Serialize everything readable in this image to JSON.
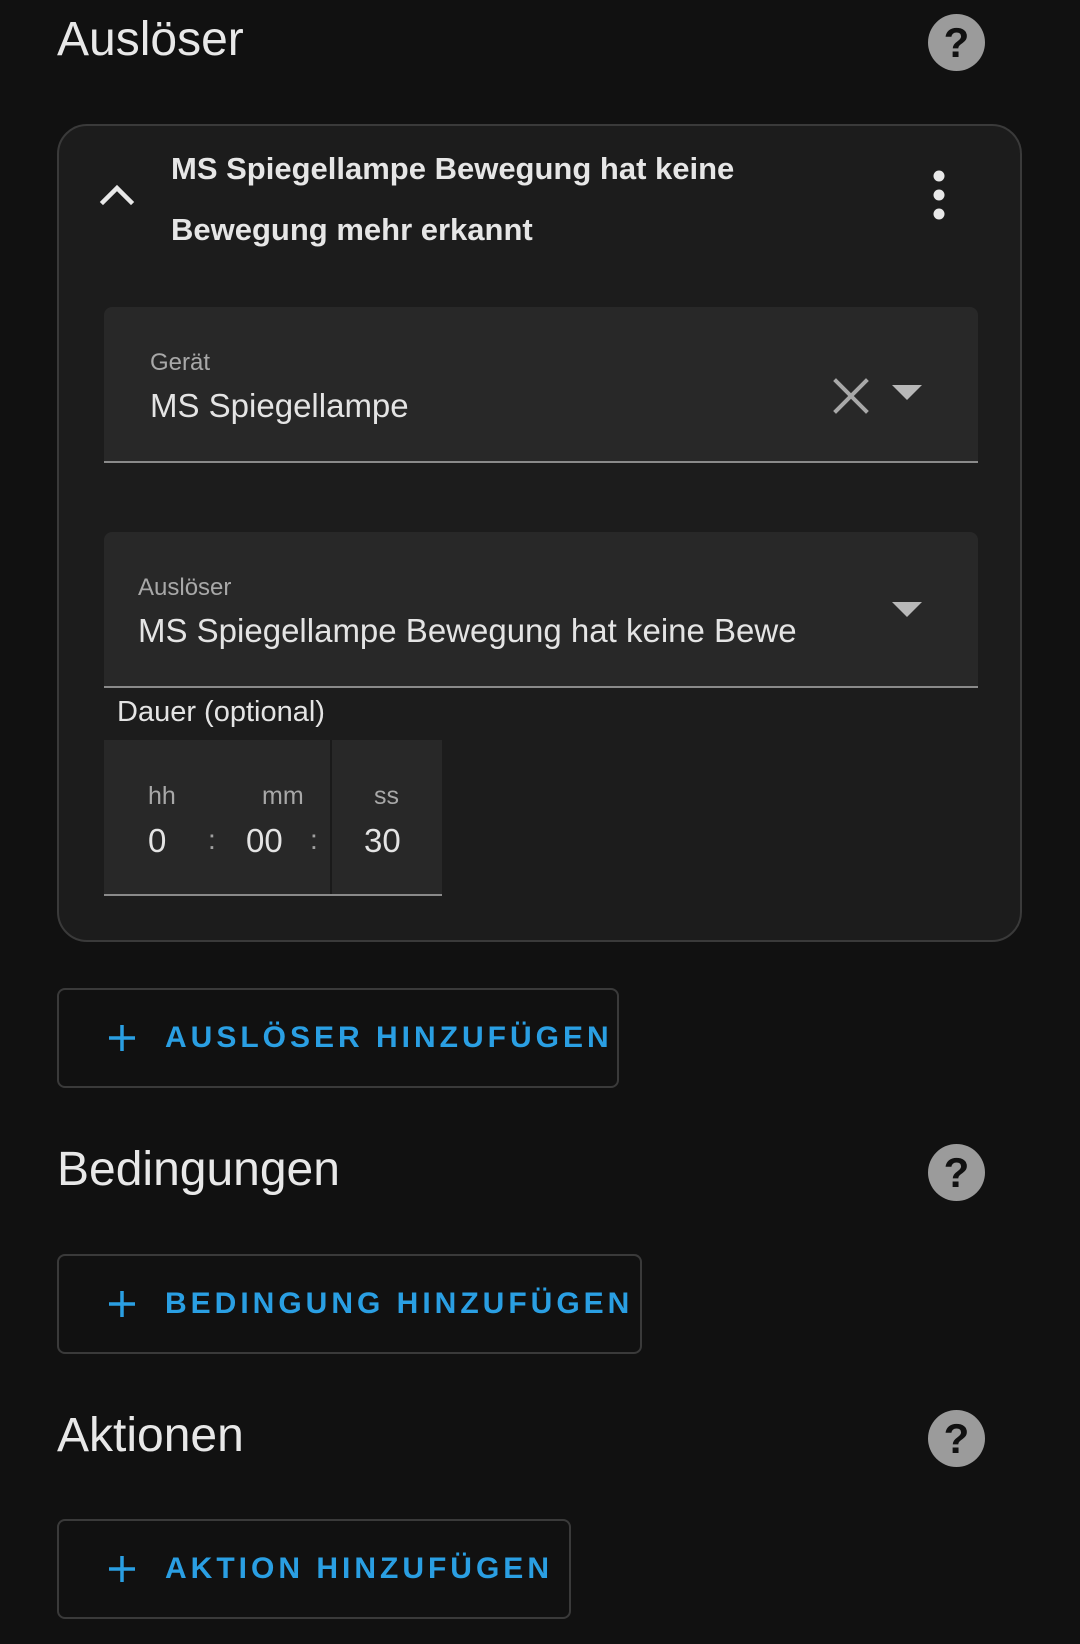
{
  "triggers_section": {
    "title": "Auslöser",
    "help_icon": "help-circle-icon",
    "trigger_card": {
      "title": "MS Spiegellampe Bewegung hat keine Bewegung mehr erkannt",
      "collapse_icon": "chevron-up-icon",
      "menu_icon": "dots-vertical-icon",
      "device_field": {
        "label": "Gerät",
        "value": "MS Spiegellampe"
      },
      "trigger_field": {
        "label": "Auslöser",
        "value": "MS Spiegellampe Bewegung hat keine Bewe"
      },
      "duration": {
        "label": "Dauer (optional)",
        "hours_label": "hh",
        "minutes_label": "mm",
        "seconds_label": "ss",
        "hours": "0",
        "minutes": "00",
        "seconds": "30",
        "separator": ":"
      }
    },
    "add_button_label": "AUSLÖSER HINZUFÜGEN"
  },
  "conditions_section": {
    "title": "Bedingungen",
    "help_icon": "help-circle-icon",
    "add_button_label": "BEDINGUNG HINZUFÜGEN"
  },
  "actions_section": {
    "title": "Aktionen",
    "help_icon": "help-circle-icon",
    "add_button_label": "AKTION HINZUFÜGEN"
  },
  "colors": {
    "background": "#111111",
    "card_background": "#1c1c1c",
    "field_background": "#282828",
    "accent": "#2a9fe3",
    "help_icon": "#9b9b9b"
  }
}
